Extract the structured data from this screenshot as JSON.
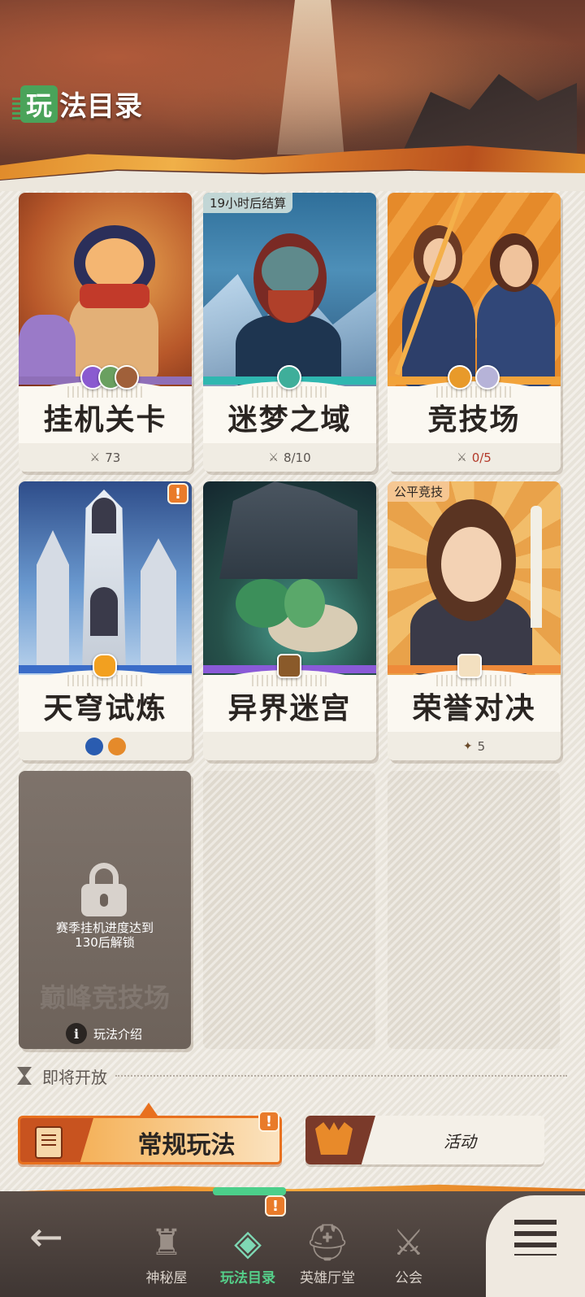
{
  "header": {
    "title_badge": "玩",
    "title_rest": "法目录"
  },
  "cards": [
    {
      "name": "挂机关卡",
      "footer": "73",
      "tag": ""
    },
    {
      "name": "迷梦之域",
      "footer": "8/10",
      "tag": "19小时后结算"
    },
    {
      "name": "竞技场",
      "footer": "0/5",
      "tag": ""
    },
    {
      "name": "天穹试炼",
      "footer": "",
      "tag": "",
      "badge": "!"
    },
    {
      "name": "异界迷宫",
      "footer": "",
      "tag": ""
    },
    {
      "name": "荣誉对决",
      "footer": "5",
      "tag": "公平竞技"
    }
  ],
  "locked_card": {
    "lock_text_line1": "赛季挂机进度达到",
    "lock_text_line2": "130后解锁",
    "ghost_name": "巅峰竞技场",
    "intro_label": "玩法介绍",
    "info_glyph": "i"
  },
  "coming_soon": {
    "label": "即将开放"
  },
  "mode_tabs": {
    "regular": "常规玩法",
    "regular_badge": "!",
    "activity": "活动"
  },
  "nav": {
    "items": [
      {
        "label": "神秘屋",
        "glyph": "♜"
      },
      {
        "label": "玩法目录",
        "glyph": "◈",
        "badge": "!"
      },
      {
        "label": "英雄厅堂",
        "glyph": "⛑"
      },
      {
        "label": "公会",
        "glyph": "⚔"
      }
    ],
    "back_glyph": "←"
  },
  "colors": {
    "accent_green": "#4aa35a",
    "accent_orange": "#e8701e",
    "nav_active": "#55d08a",
    "alert_red": "#b33a2a"
  }
}
